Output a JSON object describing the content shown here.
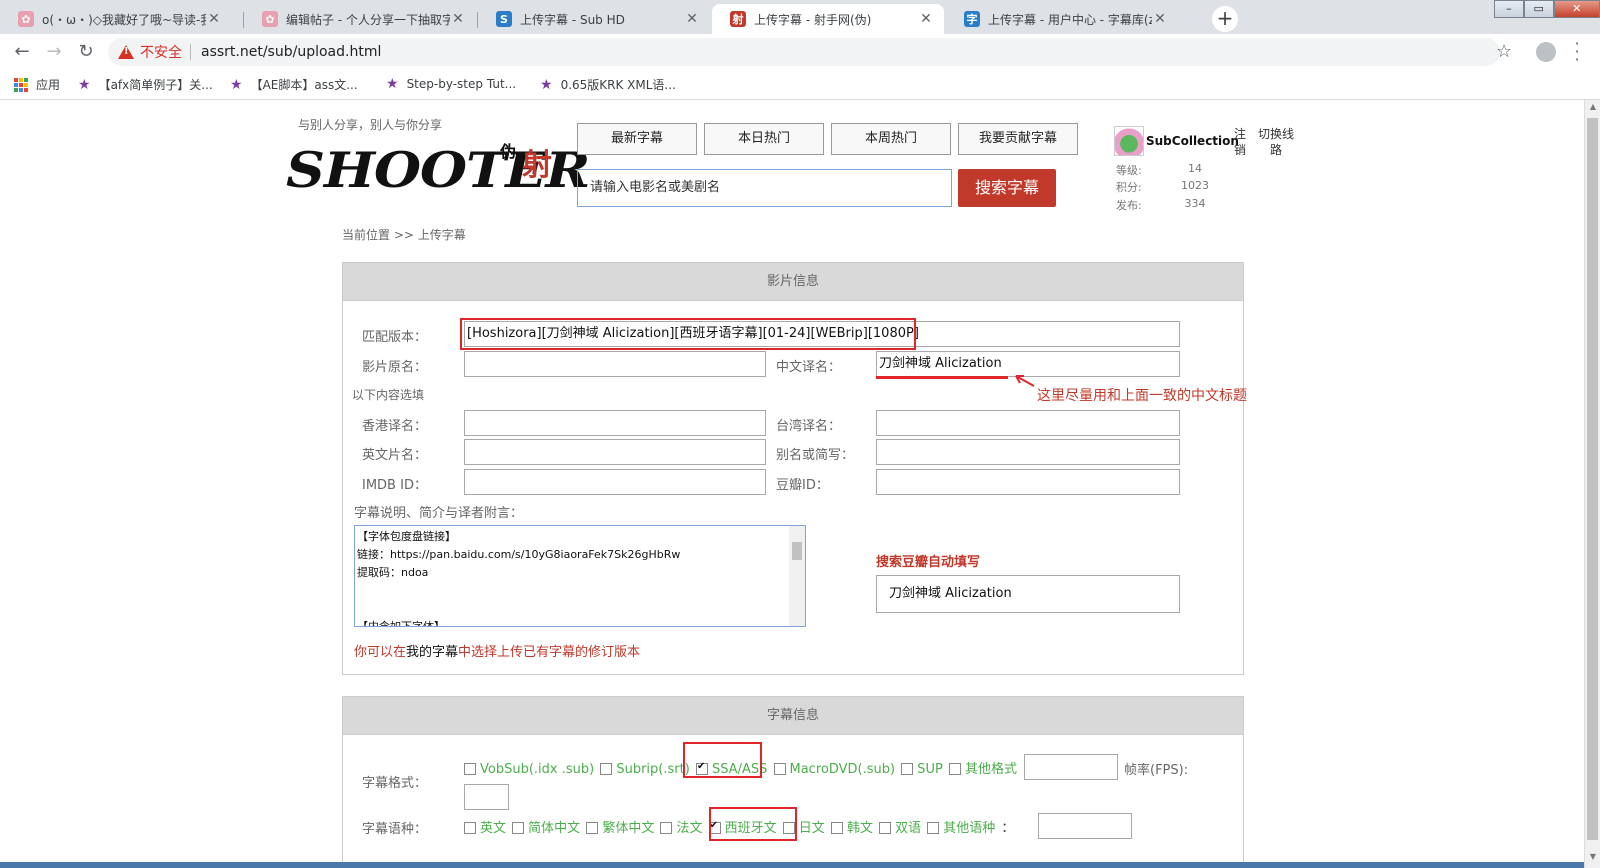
{
  "tabs": [
    {
      "title": "o(・ω・)◇我藏好了哦~导读-我的",
      "icon_color": "#e8a0b0",
      "active": false
    },
    {
      "title": "编辑帖子 - 个人分享一下抽取字幕",
      "icon_color": "#e8a0b0",
      "active": false
    },
    {
      "title": "上传字幕 - Sub HD",
      "icon_color": "#2a7ec8",
      "icon_glyph": "S",
      "active": false
    },
    {
      "title": "上传字幕 - 射手网(伪)",
      "icon_color": "#c0392b",
      "icon_glyph": "射",
      "active": true
    },
    {
      "title": "上传字幕 - 用户中心 - 字幕库(zim",
      "icon_color": "#2a7ec8",
      "icon_glyph": "字",
      "active": false
    }
  ],
  "window_controls": {
    "minimize": "–",
    "maximize": "▭",
    "close": "✕"
  },
  "toolbar": {
    "back": "←",
    "forward": "→",
    "reload": "↻",
    "insecure_label": "不安全",
    "url": "assrt.net/sub/upload.html",
    "star": "☆"
  },
  "bookmarks": [
    {
      "label": "应用",
      "icon": "apps-grid-icon"
    },
    {
      "label": "【afx简单例子】关...",
      "icon": "star-icon"
    },
    {
      "label": "【AE脚本】ass文...",
      "icon": "star-icon"
    },
    {
      "label": "Step-by-step Tut...",
      "icon": "star-icon"
    },
    {
      "label": "0.65版KRK XML语...",
      "icon": "star-icon"
    }
  ],
  "header": {
    "slogan": "与别人分享，别人与你分享",
    "logo_text": "SHOOTER",
    "logo_seal": "射",
    "logo_seal_small": "伪",
    "nav": [
      "最新字幕",
      "本日热门",
      "本周热门",
      "我要贡献字幕"
    ],
    "search_placeholder": "请输入电影名或美剧名",
    "search_button": "搜索字幕"
  },
  "user": {
    "name": "SubCollection",
    "logout": "注销",
    "switch_route": "切换线路",
    "stats": [
      {
        "label": "等级:",
        "value": "14"
      },
      {
        "label": "积分:",
        "value": "1023"
      },
      {
        "label": "发布:",
        "value": "334"
      }
    ]
  },
  "breadcrumb": "当前位置 >> 上传字幕",
  "film_panel": {
    "title": "影片信息",
    "match_version_label": "匹配版本：",
    "match_version_value": "[Hoshizora][刀剑神域 Alicization][西班牙语字幕][01-24][WEBrip][1080P]",
    "original_title_label": "影片原名：",
    "original_title_value": "",
    "chinese_title_label": "中文译名：",
    "chinese_title_value": "刀剑神域 Alicization",
    "annotation": "这里尽量用和上面一致的中文标题",
    "optional_note": "以下内容选填",
    "hk_title_label": "香港译名：",
    "tw_title_label": "台湾译名：",
    "en_title_label": "英文片名：",
    "alias_label": "别名或简写：",
    "imdb_label": "IMDB ID：",
    "douban_label": "豆瓣ID：",
    "desc_label": "字幕说明、简介与译者附言：",
    "desc_lines": [
      "【字体包度盘链接】",
      "链接：https://pan.baidu.com/s/10yG8iaoraFek7Sk26gHbRw",
      "提取码：ndoa",
      "",
      "",
      "【内含如下字体】"
    ],
    "douban_search_label": "搜索豆瓣自动填写",
    "douban_search_value": "刀剑神域 Alicization",
    "revision_note_1": "你可以在",
    "revision_note_link": "我的字幕",
    "revision_note_2": "中选择上传已有字幕的修订版本"
  },
  "sub_panel": {
    "title": "字幕信息",
    "format_label": "字幕格式：",
    "formats": [
      {
        "label": "VobSub(.idx .sub)",
        "checked": false
      },
      {
        "label": "Subrip(.srt)",
        "checked": false
      },
      {
        "label": "SSA/ASS",
        "checked": true
      },
      {
        "label": "MacroDVD(.sub)",
        "checked": false
      },
      {
        "label": "SUP",
        "checked": false
      },
      {
        "label": "其他格式",
        "checked": false
      }
    ],
    "other_format_sep": "：",
    "fps_label": "帧率(FPS):",
    "language_label": "字幕语种：",
    "languages": [
      {
        "label": "英文",
        "checked": false
      },
      {
        "label": "简体中文",
        "checked": false
      },
      {
        "label": "繁体中文",
        "checked": false
      },
      {
        "label": "法文",
        "checked": false
      },
      {
        "label": "西班牙文",
        "checked": true
      },
      {
        "label": "日文",
        "checked": false
      },
      {
        "label": "韩文",
        "checked": false
      },
      {
        "label": "双语",
        "checked": false
      },
      {
        "label": "其他语种",
        "checked": false
      }
    ],
    "other_lang_sep": "："
  },
  "colors": {
    "accent_red": "#c0392b",
    "annotation_red": "#e0262b",
    "option_green": "#4cae4c",
    "panel_header": "#d9d9d9"
  }
}
